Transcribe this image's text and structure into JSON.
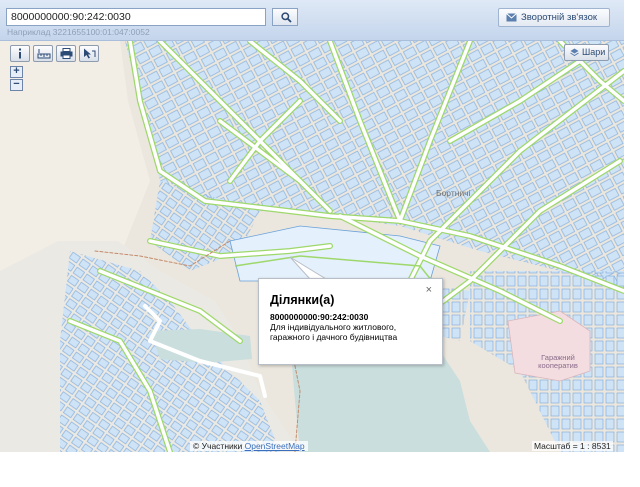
{
  "search": {
    "value": "8000000000:90:242:0030",
    "hint": "Наприклад 3221655100:01:047:0052"
  },
  "header": {
    "feedback_label": "Зворотній зв'язок"
  },
  "toolbar": {
    "layers_label": "Шари",
    "zoom_in": "+",
    "zoom_out": "−"
  },
  "popup": {
    "title": "Ділянки(а)",
    "cadastral_number": "8000000000:90:242:0030",
    "purpose": "Для індивідуального житлового, гаражного і дачного будівництва",
    "close": "×"
  },
  "map_labels": {
    "district": "Бортничі",
    "garage": "Гаражний кооператив"
  },
  "footer": {
    "attribution_prefix": "© Участники",
    "attribution_link": "OpenStreetMap",
    "scale_label": "Масштаб = 1 : 8531"
  },
  "colors": {
    "road_outline": "#9ed86a",
    "parcel_fill": "#cfe3f7",
    "parcel_stroke": "#7aa8d8",
    "water": "#c9dedd",
    "header_blue": "#c4d5ec"
  },
  "icons": [
    "search-icon",
    "envelope-icon",
    "info-icon",
    "ruler-icon",
    "print-icon",
    "pointer-icon",
    "layers-icon",
    "close-icon"
  ]
}
